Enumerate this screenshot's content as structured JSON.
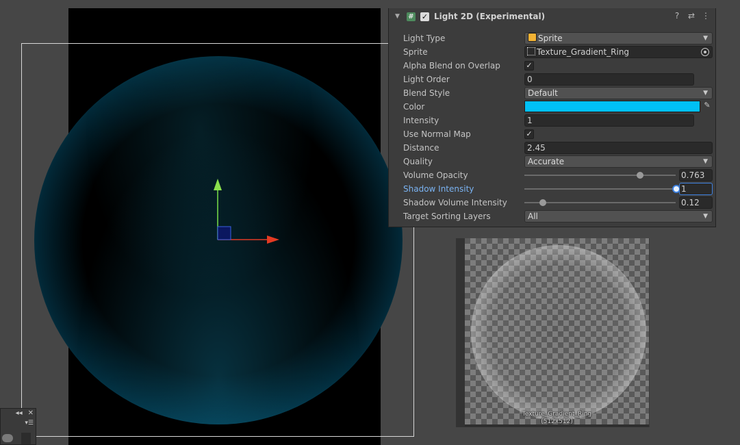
{
  "inspector": {
    "component_title": "Light 2D (Experimental)",
    "header_icons": [
      "help-icon",
      "preset-icon",
      "kebab-menu-icon"
    ],
    "properties": {
      "light_type": {
        "label": "Light Type",
        "value": "Sprite"
      },
      "sprite": {
        "label": "Sprite",
        "value": "Texture_Gradient_Ring"
      },
      "alpha_blend": {
        "label": "Alpha Blend on Overlap",
        "checked": true
      },
      "light_order": {
        "label": "Light Order",
        "value": "0"
      },
      "blend_style": {
        "label": "Blend Style",
        "value": "Default"
      },
      "color": {
        "label": "Color",
        "value": "#00c0f6"
      },
      "intensity": {
        "label": "Intensity",
        "value": "1"
      },
      "use_normal_map": {
        "label": "Use Normal Map",
        "checked": true
      },
      "distance": {
        "label": "Distance",
        "value": "2.45"
      },
      "quality": {
        "label": "Quality",
        "value": "Accurate"
      },
      "volume_opacity": {
        "label": "Volume Opacity",
        "value": "0.763",
        "fraction": 0.763
      },
      "shadow_intensity": {
        "label": "Shadow Intensity",
        "value": "1",
        "fraction": 1.0
      },
      "shadow_volume_intensity": {
        "label": "Shadow Volume Intensity",
        "value": "0.12",
        "fraction": 0.12
      },
      "target_sorting_layers": {
        "label": "Target Sorting Layers",
        "value": "All"
      }
    }
  },
  "preview": {
    "texture_name": "Texture_Gradient_Ring",
    "texture_size": "(512x512)"
  },
  "colors": {
    "light_color": "#00c0f6",
    "selection_blue": "#3d80df",
    "active_label": "#7ab3f2"
  }
}
